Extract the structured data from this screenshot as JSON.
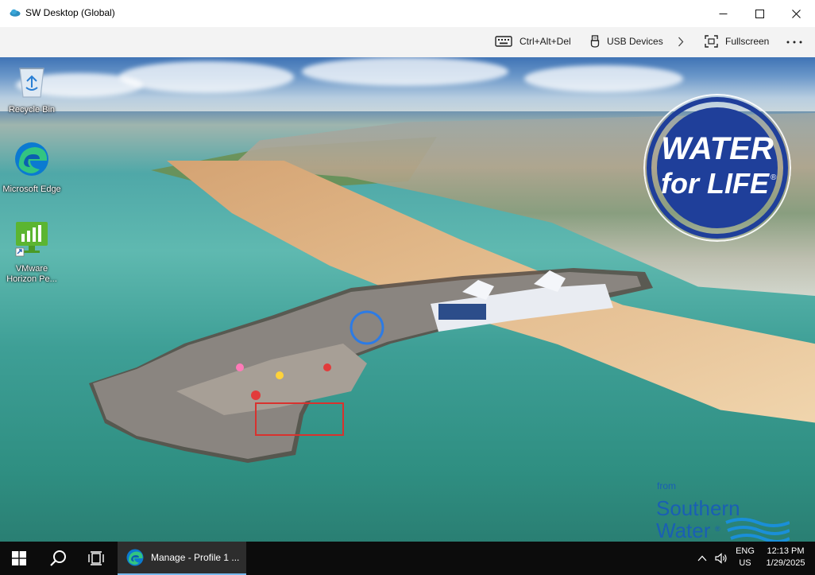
{
  "window": {
    "title": "SW Desktop (Global)",
    "minimize_icon": "minimize-icon",
    "maximize_icon": "maximize-icon",
    "close_icon": "close-icon"
  },
  "toolbar": {
    "ctrl_alt_del": "Ctrl+Alt+Del",
    "usb_devices": "USB Devices",
    "fullscreen": "Fullscreen",
    "more_icon": "more-icon"
  },
  "desktop": {
    "icons": [
      {
        "label": "Recycle Bin",
        "icon": "recycle-bin-icon"
      },
      {
        "label": "Microsoft Edge",
        "icon": "edge-icon"
      },
      {
        "label": "VMware Horizon Pe...",
        "icon": "vmware-horizon-icon"
      }
    ],
    "wallpaper": {
      "badge_line1": "WATER",
      "badge_line2": "for LIFE",
      "badge_reg": "®",
      "logo_from": "from",
      "logo_line1": "Southern",
      "logo_line2": "Water",
      "logo_reg": "®"
    }
  },
  "taskbar": {
    "start_icon": "windows-start-icon",
    "search_icon": "search-icon",
    "taskview_icon": "task-view-icon",
    "active_app": "Manage - Profile 1 ...",
    "lang_line1": "ENG",
    "lang_line2": "US",
    "time": "12:13 PM",
    "date": "1/29/2025"
  },
  "colors": {
    "taskbar": "#0c0c0c",
    "badge_blue": "#1f3f9a",
    "logo_blue": "#1a5fb4",
    "toolbar": "#f3f3f3"
  }
}
